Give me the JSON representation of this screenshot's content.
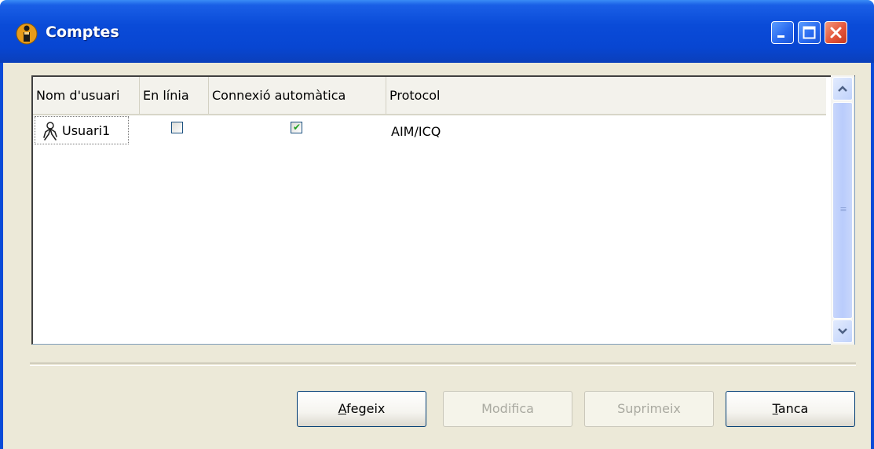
{
  "window": {
    "title": "Comptes",
    "app_icon": "user-info-icon",
    "buttons": [
      "minimize-icon",
      "maximize-icon",
      "close-icon"
    ]
  },
  "table": {
    "columns": [
      "Nom d'usuari",
      "En línia",
      "Connexió automàtica",
      "Protocol"
    ],
    "rows": [
      {
        "username": "Usuari1",
        "online": false,
        "auto_connect": true,
        "protocol": "AIM/ICQ"
      }
    ]
  },
  "buttons": {
    "add": {
      "accel": "A",
      "rest": "fegeix"
    },
    "modify": {
      "label": "Modifica"
    },
    "delete": {
      "label": "Suprimeix"
    },
    "close": {
      "accel": "T",
      "rest": "anca"
    }
  },
  "colors": {
    "titlebar": "#0a4bd8",
    "dialog_bg": "#ece9d8",
    "checkmark": "#21a121",
    "close_button": "#e4553a"
  }
}
